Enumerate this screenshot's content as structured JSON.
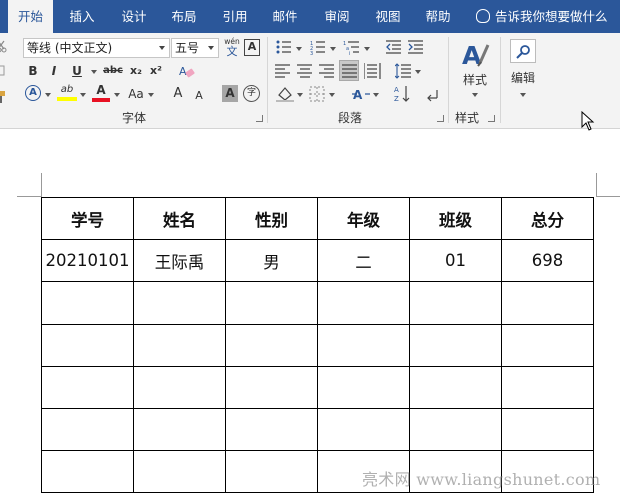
{
  "tabs": [
    {
      "label": "开始",
      "active": true
    },
    {
      "label": "插入"
    },
    {
      "label": "设计"
    },
    {
      "label": "布局"
    },
    {
      "label": "引用"
    },
    {
      "label": "邮件"
    },
    {
      "label": "审阅"
    },
    {
      "label": "视图"
    },
    {
      "label": "帮助"
    }
  ],
  "tell_me": "告诉我你想要做什么",
  "font": {
    "name": "等线 (中文正文)",
    "size": "五号",
    "phonetic_top": "wén",
    "phonetic_bottom": "文",
    "border_char": "A",
    "bold": "B",
    "italic": "I",
    "underline": "U",
    "strike": "abc",
    "subscript": "x₂",
    "superscript": "x²",
    "text_effect": "A",
    "highlight": "ab",
    "font_color": "A",
    "change_case": "Aa",
    "grow": "A",
    "shrink": "A",
    "char_shade": "A",
    "enclose": "字"
  },
  "groups": {
    "font_label": "字体",
    "paragraph_label": "段落",
    "styles_label": "样式"
  },
  "styles_button": "样式",
  "edit_button": "编辑",
  "colors": {
    "ribbon_blue": "#2b579a",
    "highlight_yellow": "#ffff00",
    "font_red": "#e81123"
  },
  "table": {
    "headers": [
      "学号",
      "姓名",
      "性别",
      "年级",
      "班级",
      "总分"
    ],
    "rows": [
      [
        "20210101",
        "王际禹",
        "男",
        "二",
        "01",
        "698"
      ],
      [
        "",
        "",
        "",
        "",
        "",
        ""
      ],
      [
        "",
        "",
        "",
        "",
        "",
        ""
      ],
      [
        "",
        "",
        "",
        "",
        "",
        ""
      ],
      [
        "",
        "",
        "",
        "",
        "",
        ""
      ],
      [
        "",
        "",
        "",
        "",
        "",
        ""
      ]
    ]
  },
  "watermark": "亮术网 www.liangshunet.com"
}
